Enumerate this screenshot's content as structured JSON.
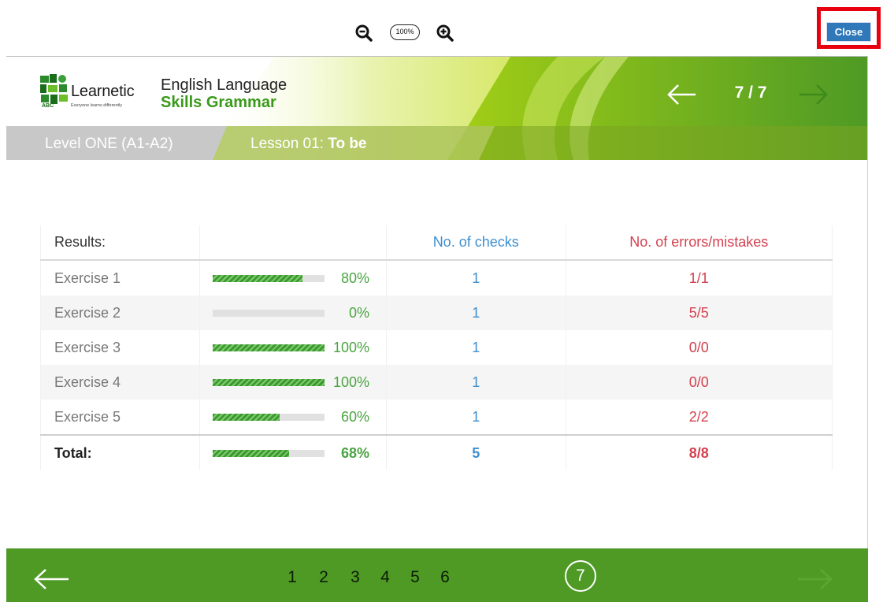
{
  "toolbar": {
    "zoom_out_icon": "zoom-out-icon",
    "zoom_in_icon": "zoom-in-icon",
    "zoom_level": "100%",
    "close_label": "Close"
  },
  "header": {
    "logo_text": "Learnetic",
    "logo_tagline": "Everyone learns differently",
    "course_title": "English Language",
    "course_subtitle": "Skills Grammar",
    "page_indicator": "7 / 7",
    "level": "Level ONE (A1-A2)",
    "lesson_prefix": "Lesson 01:",
    "lesson_topic": "To be"
  },
  "results": {
    "columns": [
      "Results:",
      "",
      "No. of checks",
      "No. of errors/mistakes"
    ],
    "rows": [
      {
        "name": "Exercise 1",
        "progress": 80,
        "progress_label": "80%",
        "checks": "1",
        "errors": "1/1"
      },
      {
        "name": "Exercise 2",
        "progress": 0,
        "progress_label": "0%",
        "checks": "1",
        "errors": "5/5"
      },
      {
        "name": "Exercise 3",
        "progress": 100,
        "progress_label": "100%",
        "checks": "1",
        "errors": "0/0"
      },
      {
        "name": "Exercise 4",
        "progress": 100,
        "progress_label": "100%",
        "checks": "1",
        "errors": "0/0"
      },
      {
        "name": "Exercise 5",
        "progress": 60,
        "progress_label": "60%",
        "checks": "1",
        "errors": "2/2"
      }
    ],
    "total": {
      "name": "Total:",
      "progress": 68,
      "progress_label": "68%",
      "checks": "5",
      "errors": "8/8"
    }
  },
  "footer": {
    "pages": [
      "1",
      "2",
      "3",
      "4",
      "5",
      "6",
      "7"
    ],
    "current_page": "7"
  },
  "colors": {
    "accent_green": "#4e9a25",
    "checks_blue": "#3f8fcf",
    "errors_red": "#d3414f",
    "close_blue": "#2f78b9",
    "highlight_red": "#e8000e"
  }
}
